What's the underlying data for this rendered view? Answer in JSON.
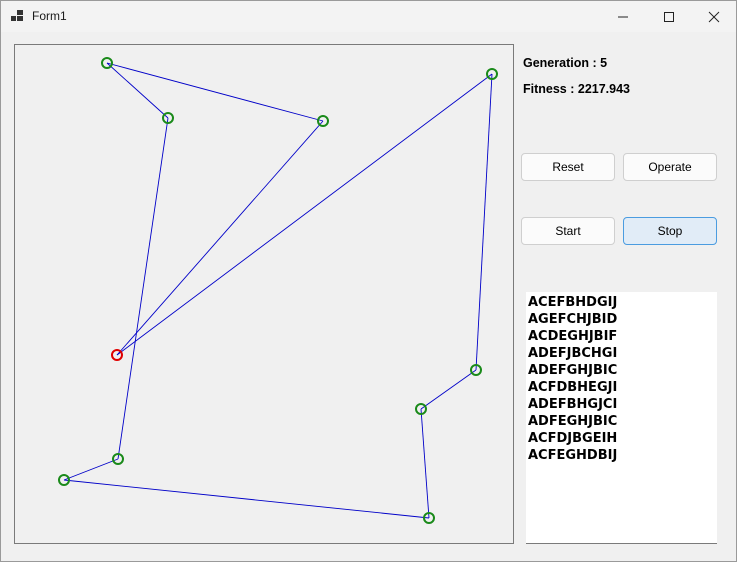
{
  "window": {
    "title": "Form1"
  },
  "status": {
    "generation_text": "Generation : 5",
    "fitness_text": "Fitness : 2217.943"
  },
  "buttons": {
    "reset": "Reset",
    "operate": "Operate",
    "start": "Start",
    "stop": "Stop"
  },
  "population": [
    "ACEFBHDGIJ",
    "AGEFCHJBID",
    "ACDEGHJBIF",
    "ADEFJBCHGI",
    "ADEFGHJBIC",
    "ACFDBHEGJI",
    "ADEFBHGJCI",
    "ADFEGHJBIC",
    "ACFDJBGEIH",
    "ACFEGHDBIJ"
  ],
  "route": {
    "colors": {
      "path": "#0000c8",
      "city": "#1a8a1a",
      "start": "#e00000"
    }
  }
}
